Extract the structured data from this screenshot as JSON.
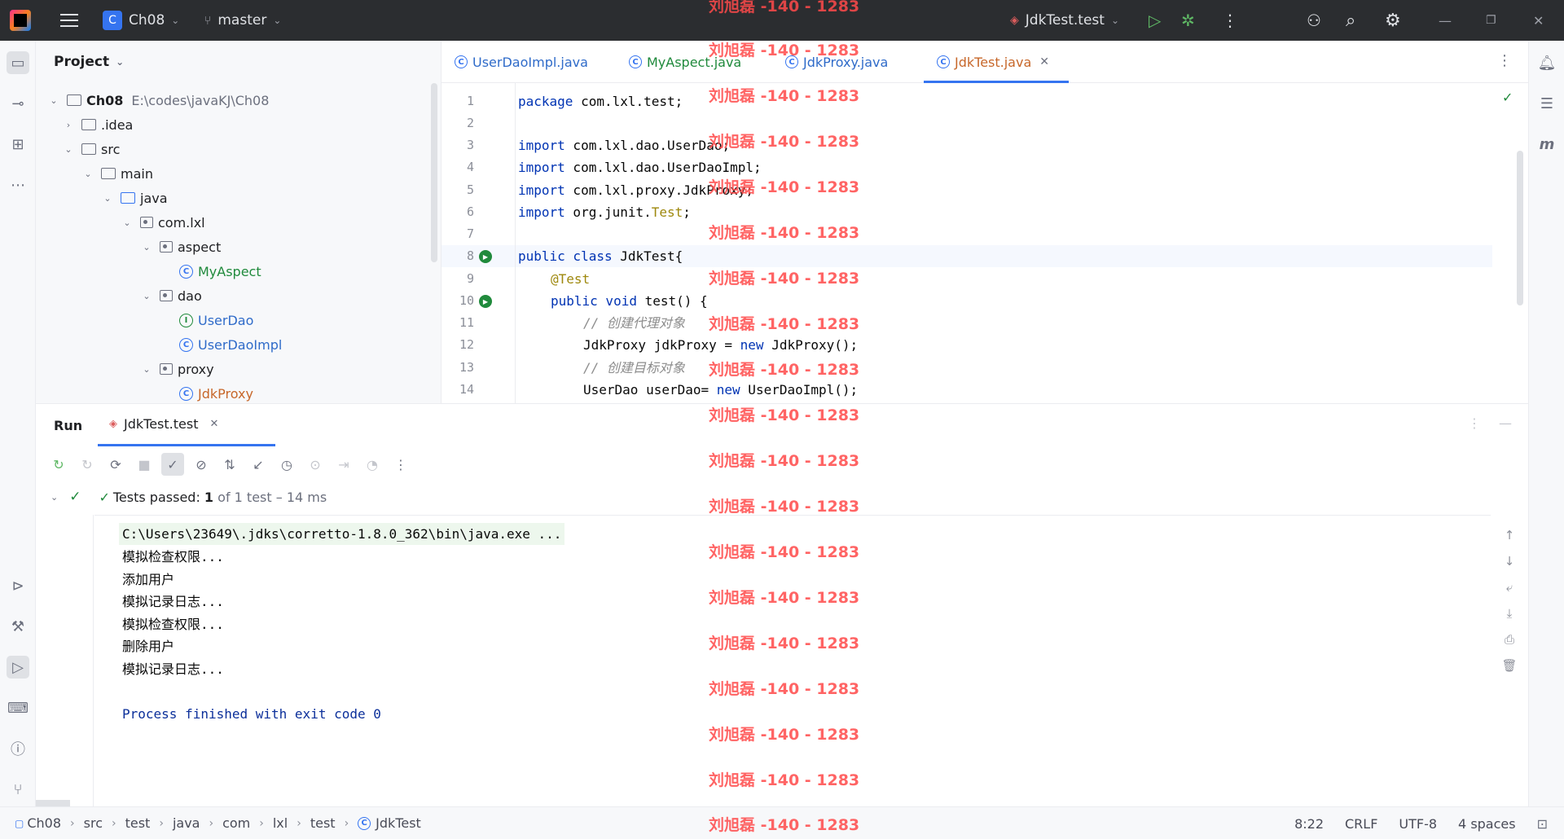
{
  "titlebar": {
    "project_badge": "C",
    "project_name": "Ch08",
    "branch": "master",
    "run_config": "JdkTest.test"
  },
  "project_panel": {
    "title": "Project",
    "root_name": "Ch08",
    "root_path": "E:\\codes\\javaKJ\\Ch08",
    "items": [
      {
        "label": ".idea"
      },
      {
        "label": "src"
      },
      {
        "label": "main"
      },
      {
        "label": "java"
      },
      {
        "label": "com.lxl"
      },
      {
        "label": "aspect"
      },
      {
        "label": "MyAspect"
      },
      {
        "label": "dao"
      },
      {
        "label": "UserDao"
      },
      {
        "label": "UserDaoImpl"
      },
      {
        "label": "proxy"
      },
      {
        "label": "JdkProxy"
      }
    ]
  },
  "editor": {
    "tabs": [
      {
        "label": "UserDaoImpl.java"
      },
      {
        "label": "MyAspect.java"
      },
      {
        "label": "JdkProxy.java"
      },
      {
        "label": "JdkTest.java"
      }
    ],
    "line_numbers": [
      "1",
      "2",
      "3",
      "4",
      "5",
      "6",
      "7",
      "8",
      "9",
      "10",
      "11",
      "12",
      "13",
      "14"
    ],
    "code": {
      "l1_kw": "package",
      "l1_rest": " com.lxl.test;",
      "l3_kw": "import",
      "l3_rest": " com.lxl.dao.UserDao;",
      "l4_kw": "import",
      "l4_rest": " com.lxl.dao.UserDaoImpl;",
      "l5_kw": "import",
      "l5_rest": " com.lxl.proxy.JdkProxy;",
      "l6_kw": "import",
      "l6_rest": " org.junit.",
      "l6_cls": "Test",
      "l6_end": ";",
      "l8_kw": "public class",
      "l8_rest": " JdkTest{",
      "l9_ann": "@Test",
      "l10_kw": "public void",
      "l10_rest": " test() {",
      "l11_cm": "// 创建代理对象",
      "l12_a": "JdkProxy jdkProxy = ",
      "l12_kw": "new",
      "l12_b": " JdkProxy();",
      "l13_cm": "// 创建目标对象",
      "l14_a": "UserDao userDao= ",
      "l14_kw": "new",
      "l14_b": " UserDaoImpl();"
    }
  },
  "run_panel": {
    "title": "Run",
    "tab_label": "JdkTest.test",
    "status_prefix": "Tests passed: ",
    "status_count": "1",
    "status_suffix": " of 1 test – 14 ms",
    "console_lines": [
      "C:\\Users\\23649\\.jdks\\corretto-1.8.0_362\\bin\\java.exe ...",
      "模拟检查权限...",
      "添加用户",
      "模拟记录日志...",
      "模拟检查权限...",
      "删除用户",
      "模拟记录日志...",
      "",
      "Process finished with exit code 0"
    ]
  },
  "statusbar": {
    "breadcrumbs": [
      "Ch08",
      "src",
      "test",
      "java",
      "com",
      "lxl",
      "test",
      "JdkTest"
    ],
    "position": "8:22",
    "line_ending": "CRLF",
    "encoding": "UTF-8",
    "indent": "4 spaces"
  },
  "watermark": "刘旭磊 -140 - 1283"
}
